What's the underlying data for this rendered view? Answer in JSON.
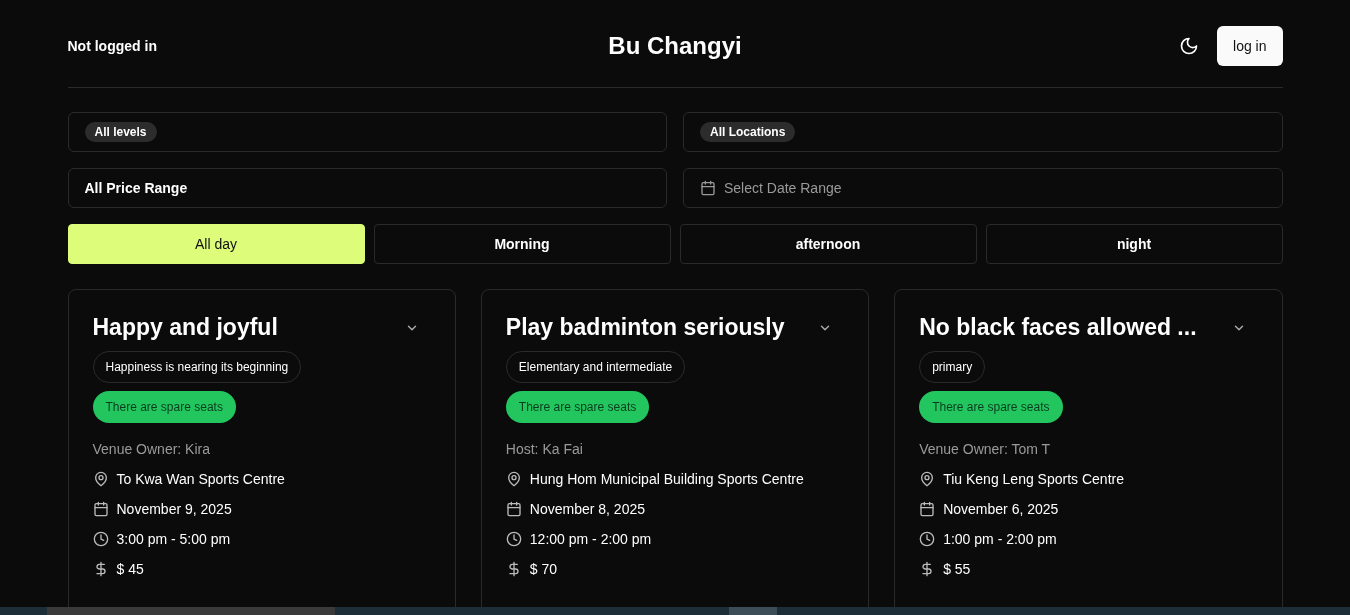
{
  "header": {
    "status": "Not logged in",
    "title": "Bu Changyi",
    "login_button": "log in"
  },
  "filters": {
    "level": {
      "chip": "All levels"
    },
    "location": {
      "chip": "All Locations"
    },
    "price": {
      "value": "All Price Range"
    },
    "date": {
      "placeholder": "Select Date Range"
    }
  },
  "time_tabs": [
    {
      "label": "All day",
      "selected": true
    },
    {
      "label": "Morning",
      "selected": false
    },
    {
      "label": "afternoon",
      "selected": false
    },
    {
      "label": "night",
      "selected": false
    }
  ],
  "cards": [
    {
      "title": "Happy and joyful",
      "level_tag": "Happiness is nearing its beginning",
      "seats_badge": "There are spare seats",
      "organizer": "Venue Owner: Kira",
      "location": "To Kwa Wan Sports Centre",
      "date": "November 9, 2025",
      "time": "3:00 pm - 5:00 pm",
      "price": "$ 45"
    },
    {
      "title": "Play badminton seriously",
      "level_tag": "Elementary and intermediate",
      "seats_badge": "There are spare seats",
      "organizer": "Host: Ka Fai",
      "location": "Hung Hom Municipal Building Sports Centre",
      "date": "November 8, 2025",
      "time": "12:00 pm - 2:00 pm",
      "price": "$ 70"
    },
    {
      "title": "No black faces allowed ...",
      "level_tag": "primary",
      "seats_badge": "There are spare seats",
      "organizer": "Venue Owner: Tom T",
      "location": "Tiu Keng Leng Sports Centre",
      "date": "November 6, 2025",
      "time": "1:00 pm - 2:00 pm",
      "price": "$ 55"
    }
  ]
}
